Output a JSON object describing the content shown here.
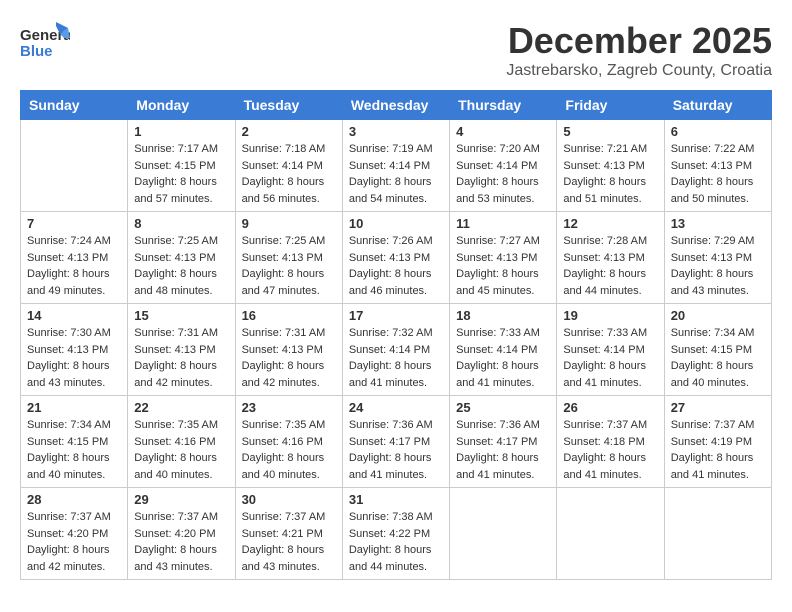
{
  "logo": {
    "general": "General",
    "blue": "Blue"
  },
  "title": {
    "month": "December 2025",
    "location": "Jastrebarsko, Zagreb County, Croatia"
  },
  "days_of_week": [
    "Sunday",
    "Monday",
    "Tuesday",
    "Wednesday",
    "Thursday",
    "Friday",
    "Saturday"
  ],
  "weeks": [
    [
      {
        "day": "",
        "info": ""
      },
      {
        "day": "1",
        "info": "Sunrise: 7:17 AM\nSunset: 4:15 PM\nDaylight: 8 hours\nand 57 minutes."
      },
      {
        "day": "2",
        "info": "Sunrise: 7:18 AM\nSunset: 4:14 PM\nDaylight: 8 hours\nand 56 minutes."
      },
      {
        "day": "3",
        "info": "Sunrise: 7:19 AM\nSunset: 4:14 PM\nDaylight: 8 hours\nand 54 minutes."
      },
      {
        "day": "4",
        "info": "Sunrise: 7:20 AM\nSunset: 4:14 PM\nDaylight: 8 hours\nand 53 minutes."
      },
      {
        "day": "5",
        "info": "Sunrise: 7:21 AM\nSunset: 4:13 PM\nDaylight: 8 hours\nand 51 minutes."
      },
      {
        "day": "6",
        "info": "Sunrise: 7:22 AM\nSunset: 4:13 PM\nDaylight: 8 hours\nand 50 minutes."
      }
    ],
    [
      {
        "day": "7",
        "info": "Sunrise: 7:24 AM\nSunset: 4:13 PM\nDaylight: 8 hours\nand 49 minutes."
      },
      {
        "day": "8",
        "info": "Sunrise: 7:25 AM\nSunset: 4:13 PM\nDaylight: 8 hours\nand 48 minutes."
      },
      {
        "day": "9",
        "info": "Sunrise: 7:25 AM\nSunset: 4:13 PM\nDaylight: 8 hours\nand 47 minutes."
      },
      {
        "day": "10",
        "info": "Sunrise: 7:26 AM\nSunset: 4:13 PM\nDaylight: 8 hours\nand 46 minutes."
      },
      {
        "day": "11",
        "info": "Sunrise: 7:27 AM\nSunset: 4:13 PM\nDaylight: 8 hours\nand 45 minutes."
      },
      {
        "day": "12",
        "info": "Sunrise: 7:28 AM\nSunset: 4:13 PM\nDaylight: 8 hours\nand 44 minutes."
      },
      {
        "day": "13",
        "info": "Sunrise: 7:29 AM\nSunset: 4:13 PM\nDaylight: 8 hours\nand 43 minutes."
      }
    ],
    [
      {
        "day": "14",
        "info": "Sunrise: 7:30 AM\nSunset: 4:13 PM\nDaylight: 8 hours\nand 43 minutes."
      },
      {
        "day": "15",
        "info": "Sunrise: 7:31 AM\nSunset: 4:13 PM\nDaylight: 8 hours\nand 42 minutes."
      },
      {
        "day": "16",
        "info": "Sunrise: 7:31 AM\nSunset: 4:13 PM\nDaylight: 8 hours\nand 42 minutes."
      },
      {
        "day": "17",
        "info": "Sunrise: 7:32 AM\nSunset: 4:14 PM\nDaylight: 8 hours\nand 41 minutes."
      },
      {
        "day": "18",
        "info": "Sunrise: 7:33 AM\nSunset: 4:14 PM\nDaylight: 8 hours\nand 41 minutes."
      },
      {
        "day": "19",
        "info": "Sunrise: 7:33 AM\nSunset: 4:14 PM\nDaylight: 8 hours\nand 41 minutes."
      },
      {
        "day": "20",
        "info": "Sunrise: 7:34 AM\nSunset: 4:15 PM\nDaylight: 8 hours\nand 40 minutes."
      }
    ],
    [
      {
        "day": "21",
        "info": "Sunrise: 7:34 AM\nSunset: 4:15 PM\nDaylight: 8 hours\nand 40 minutes."
      },
      {
        "day": "22",
        "info": "Sunrise: 7:35 AM\nSunset: 4:16 PM\nDaylight: 8 hours\nand 40 minutes."
      },
      {
        "day": "23",
        "info": "Sunrise: 7:35 AM\nSunset: 4:16 PM\nDaylight: 8 hours\nand 40 minutes."
      },
      {
        "day": "24",
        "info": "Sunrise: 7:36 AM\nSunset: 4:17 PM\nDaylight: 8 hours\nand 41 minutes."
      },
      {
        "day": "25",
        "info": "Sunrise: 7:36 AM\nSunset: 4:17 PM\nDaylight: 8 hours\nand 41 minutes."
      },
      {
        "day": "26",
        "info": "Sunrise: 7:37 AM\nSunset: 4:18 PM\nDaylight: 8 hours\nand 41 minutes."
      },
      {
        "day": "27",
        "info": "Sunrise: 7:37 AM\nSunset: 4:19 PM\nDaylight: 8 hours\nand 41 minutes."
      }
    ],
    [
      {
        "day": "28",
        "info": "Sunrise: 7:37 AM\nSunset: 4:20 PM\nDaylight: 8 hours\nand 42 minutes."
      },
      {
        "day": "29",
        "info": "Sunrise: 7:37 AM\nSunset: 4:20 PM\nDaylight: 8 hours\nand 43 minutes."
      },
      {
        "day": "30",
        "info": "Sunrise: 7:37 AM\nSunset: 4:21 PM\nDaylight: 8 hours\nand 43 minutes."
      },
      {
        "day": "31",
        "info": "Sunrise: 7:38 AM\nSunset: 4:22 PM\nDaylight: 8 hours\nand 44 minutes."
      },
      {
        "day": "",
        "info": ""
      },
      {
        "day": "",
        "info": ""
      },
      {
        "day": "",
        "info": ""
      }
    ]
  ]
}
